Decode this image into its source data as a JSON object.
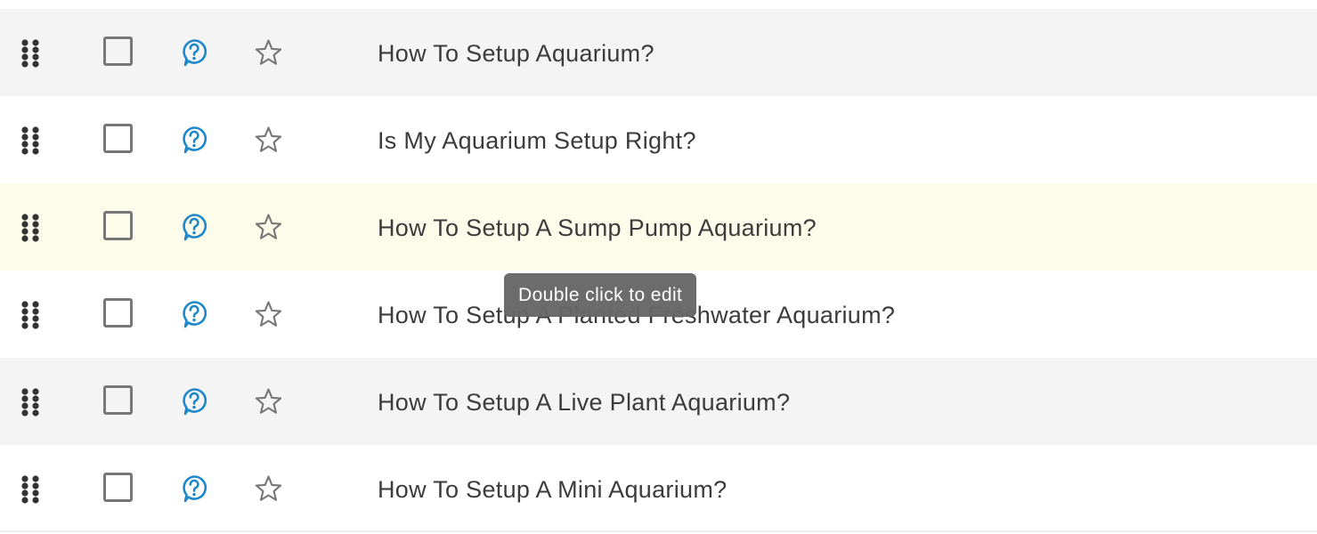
{
  "rows": [
    {
      "text": "How To Setup Aquarium?"
    },
    {
      "text": "Is My Aquarium Setup Right?"
    },
    {
      "text": "How To Setup A Sump Pump Aquarium?"
    },
    {
      "text": "How To Setup A Planted Freshwater Aquarium?"
    },
    {
      "text": "How To Setup A Live Plant Aquarium?"
    },
    {
      "text": "How To Setup A Mini Aquarium?"
    }
  ],
  "tooltip": {
    "text": "Double click to edit"
  },
  "colors": {
    "accent": "#1e88c8",
    "row_alt": "#f4f4f4",
    "row_highlight": "#fdfbea",
    "icon_gray": "#777777",
    "handle": "#333333"
  },
  "icons": {
    "drag": "drag-handle-icon",
    "question": "question-bubble-icon",
    "star": "star-outline-icon"
  }
}
